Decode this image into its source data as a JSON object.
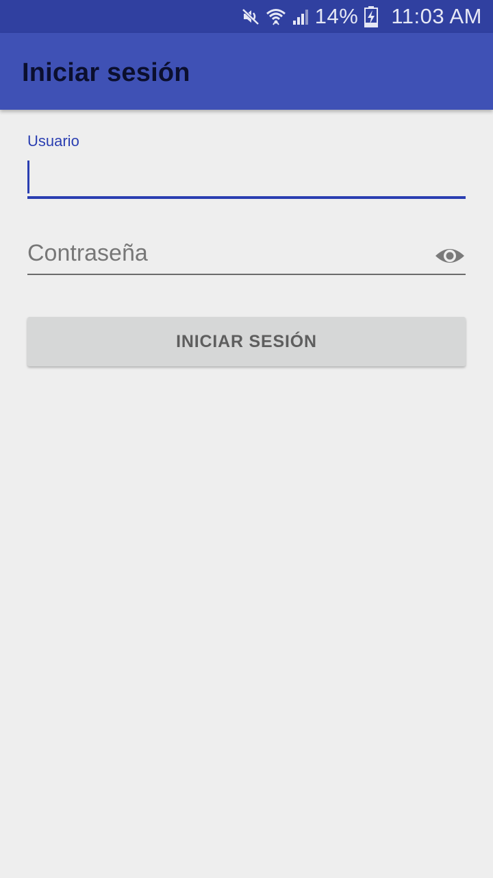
{
  "status_bar": {
    "battery_percent": "14%",
    "time": "11:03 AM",
    "icons": [
      "mute-icon",
      "wifi-icon",
      "signal-icon",
      "battery-charging-icon"
    ]
  },
  "app_bar": {
    "title": "Iniciar sesión",
    "color": "#3f51b5"
  },
  "form": {
    "username": {
      "label": "Usuario",
      "value": "",
      "accent_color": "#2a3eb1"
    },
    "password": {
      "placeholder": "Contraseña",
      "value": "",
      "toggle_icon": "eye-icon"
    },
    "submit_label": "INICIAR SESIÓN"
  }
}
